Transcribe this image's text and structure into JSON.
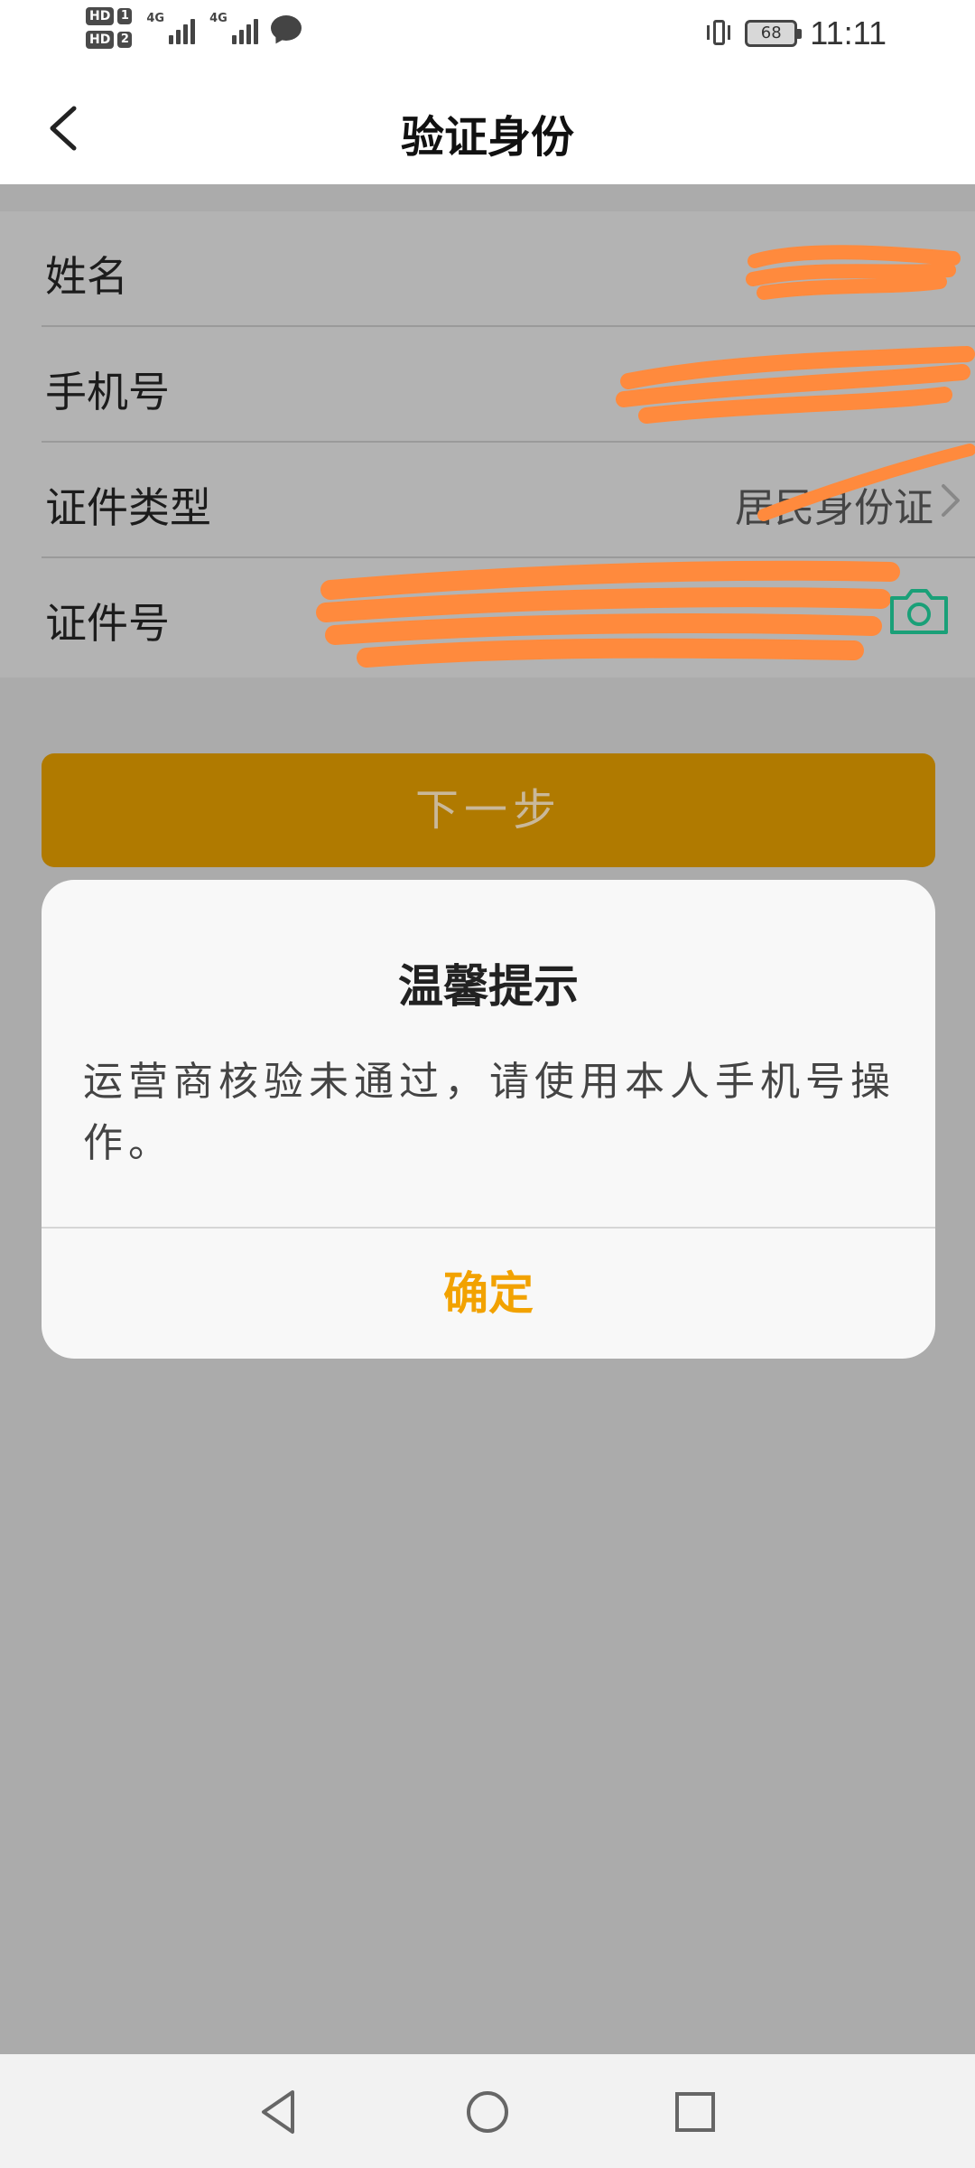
{
  "status_bar": {
    "hd_label": "HD",
    "sim1": "1",
    "sim2": "2",
    "network1": "4G",
    "network2": "4G",
    "battery": "68",
    "time": "11:11"
  },
  "header": {
    "title": "验证身份",
    "back_icon": "chevron-left-icon"
  },
  "form": {
    "rows": [
      {
        "label": "姓名",
        "value": ""
      },
      {
        "label": "手机号",
        "value": ""
      },
      {
        "label": "证件类型",
        "value": "居民身份证"
      },
      {
        "label": "证件号",
        "value": ""
      }
    ],
    "camera_icon": "camera-icon",
    "scribble_color": "#ff8a3d",
    "camera_color": "#1aa078"
  },
  "next_button": {
    "label": "下一步",
    "color": "#b07a00"
  },
  "dialog": {
    "title": "温馨提示",
    "message": "运营商核验未通过，请使用本人手机号操作。",
    "confirm_label": "确定",
    "confirm_color": "#f2a200"
  },
  "navbar": {
    "back_icon": "triangle-back-icon",
    "home_icon": "circle-home-icon",
    "recents_icon": "square-recents-icon"
  }
}
